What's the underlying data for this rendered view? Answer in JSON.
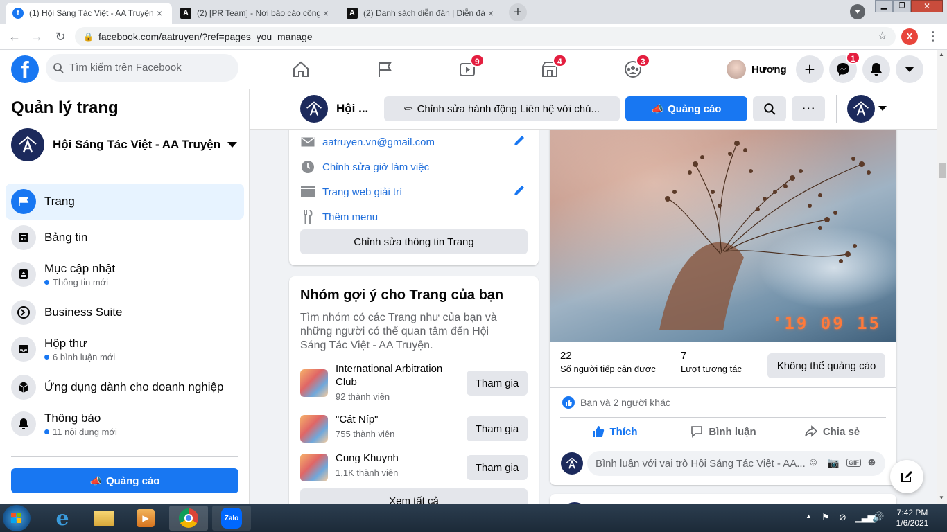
{
  "browser": {
    "tabs": [
      {
        "title": "(1) Hội Sáng Tác Việt - AA Truyện",
        "close": "×"
      },
      {
        "title": "(2) [PR Team] - Nơi báo cáo công",
        "close": "×"
      },
      {
        "title": "(2) Danh sách diễn đàn | Diễn đàn",
        "close": "×"
      }
    ],
    "new_tab": "+",
    "url": "facebook.com/aatruyen/?ref=pages_you_manage",
    "profile_letter": "X",
    "tab_icon_letter": "A"
  },
  "fb_nav": {
    "search_placeholder": "Tìm kiếm trên Facebook",
    "badges": {
      "watch": "9",
      "marketplace": "4",
      "groups": "3",
      "messenger": "1"
    },
    "user_name": "Hương"
  },
  "sidebar": {
    "title": "Quản lý trang",
    "page_name": "Hội Sáng Tác Việt - AA Truyện",
    "items": [
      {
        "label": "Trang",
        "sub": ""
      },
      {
        "label": "Bảng tin",
        "sub": ""
      },
      {
        "label": "Mục cập nhật",
        "sub": "Thông tin mới"
      },
      {
        "label": "Business Suite",
        "sub": ""
      },
      {
        "label": "Hộp thư",
        "sub": "6 bình luận mới"
      },
      {
        "label": "Ứng dụng dành cho doanh nghiệp",
        "sub": ""
      },
      {
        "label": "Thông báo",
        "sub": "11 nội dung mới"
      }
    ],
    "promote_button": "Quảng cáo"
  },
  "page_bar": {
    "page_short_name": "Hội ...",
    "edit_action": "Chỉnh sửa hành động Liên hệ với chú...",
    "promote": "Quảng cáo"
  },
  "about_card": {
    "email": "aatruyen.vn@gmail.com",
    "hours": "Chỉnh sửa giờ làm việc",
    "website": "Trang web giải trí",
    "menu": "Thêm menu",
    "edit_button": "Chỉnh sửa thông tin Trang"
  },
  "groups_card": {
    "title": "Nhóm gợi ý cho Trang của bạn",
    "description": "Tìm nhóm có các Trang như của bạn và những người có thể quan tâm đến Hội Sáng Tác Việt - AA Truyện.",
    "groups": [
      {
        "name": "International Arbitration Club",
        "members": "92 thành viên",
        "join": "Tham gia"
      },
      {
        "name": "\"Cát Níp\"",
        "members": "755 thành viên",
        "join": "Tham gia"
      },
      {
        "name": "Cung Khuynh",
        "members": "1,1K thành viên",
        "join": "Tham gia"
      }
    ],
    "see_all": "Xem tất cả"
  },
  "post": {
    "photo_date": "'19 09 15",
    "reach_value": "22",
    "reach_label": "Số người tiếp cận được",
    "engagement_value": "7",
    "engagement_label": "Lượt tương tác",
    "cannot_promote": "Không thể quảng cáo",
    "reactions": "Bạn và 2 người khác",
    "like": "Thích",
    "comment": "Bình luận",
    "share": "Chia sẻ",
    "comment_placeholder": "Bình luận với vai trò Hội Sáng Tác Việt - AA..."
  },
  "taskbar": {
    "time": "7:42 PM",
    "date": "1/6/2021",
    "zalo": "Zalo"
  },
  "colors": {
    "fb_blue": "#1877f2",
    "badge_red": "#e41e3f",
    "page_dark": "#1c2a5c"
  }
}
